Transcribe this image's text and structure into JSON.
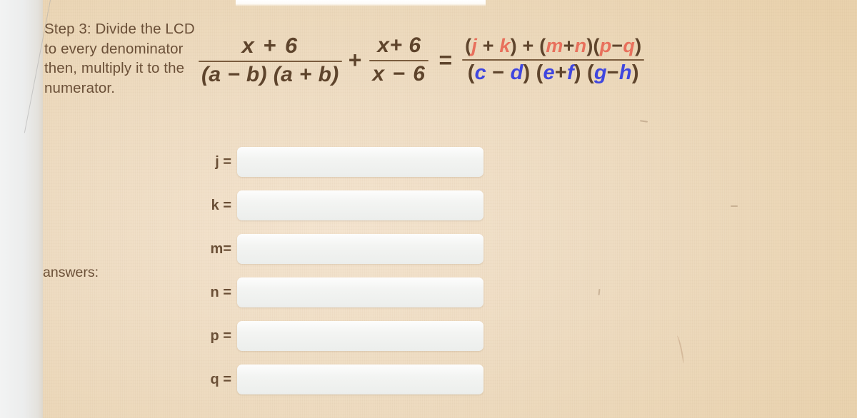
{
  "instruction": {
    "text": "Step 3: Divide the LCD to every denominator then, multiply it to the numerator."
  },
  "equation": {
    "fraction_1": {
      "numerator": "x + 6",
      "denominator": "(a − b) (a + b)"
    },
    "operator_plus": "+",
    "fraction_2": {
      "numerator": "x+ 6",
      "denominator": "x − 6"
    },
    "operator_equals": "=",
    "fraction_3": {
      "numerator_tokens": [
        {
          "text": "(",
          "color": "brown"
        },
        {
          "text": "j",
          "color": "red"
        },
        {
          "text": " + ",
          "color": "brown"
        },
        {
          "text": "k",
          "color": "red"
        },
        {
          "text": ")",
          "color": "brown"
        },
        {
          "text": " + ",
          "color": "brown"
        },
        {
          "text": "(",
          "color": "brown"
        },
        {
          "text": "m",
          "color": "red"
        },
        {
          "text": "+",
          "color": "brown"
        },
        {
          "text": "n",
          "color": "red"
        },
        {
          "text": ")",
          "color": "brown"
        },
        {
          "text": "(",
          "color": "brown"
        },
        {
          "text": "p",
          "color": "red"
        },
        {
          "text": "−",
          "color": "brown"
        },
        {
          "text": "q",
          "color": "red"
        },
        {
          "text": ")",
          "color": "brown"
        }
      ],
      "denominator_tokens": [
        {
          "text": "(",
          "color": "brown"
        },
        {
          "text": "c",
          "color": "blue"
        },
        {
          "text": " − ",
          "color": "brown"
        },
        {
          "text": "d",
          "color": "blue"
        },
        {
          "text": ")",
          "color": "brown"
        },
        {
          "text": " (",
          "color": "brown"
        },
        {
          "text": "e",
          "color": "blue"
        },
        {
          "text": "+",
          "color": "brown"
        },
        {
          "text": "f",
          "color": "blue"
        },
        {
          "text": ")",
          "color": "brown"
        },
        {
          "text": " (",
          "color": "brown"
        },
        {
          "text": "g",
          "color": "blue"
        },
        {
          "text": "−",
          "color": "brown"
        },
        {
          "text": "h",
          "color": "blue"
        },
        {
          "text": ")",
          "color": "brown"
        }
      ],
      "numerator_plain": "(j + k) + (m+n)(p−q)",
      "denominator_plain": "(c − d) (e+f) (g−h)"
    }
  },
  "answers": {
    "section_label": "answers:",
    "fields": [
      {
        "label": "j =",
        "value": "",
        "placeholder": ""
      },
      {
        "label": "k =",
        "value": "",
        "placeholder": ""
      },
      {
        "label": "m=",
        "value": "",
        "placeholder": ""
      },
      {
        "label": "n =",
        "value": "",
        "placeholder": ""
      },
      {
        "label": "p =",
        "value": "",
        "placeholder": ""
      },
      {
        "label": "q =",
        "value": "",
        "placeholder": ""
      }
    ]
  },
  "colors": {
    "paper": "#efd9bc",
    "ink_brown": "#5e442c",
    "variable_red": "#e8705c",
    "variable_blue": "#3f46df",
    "input_fill": "#f2f3f1"
  }
}
